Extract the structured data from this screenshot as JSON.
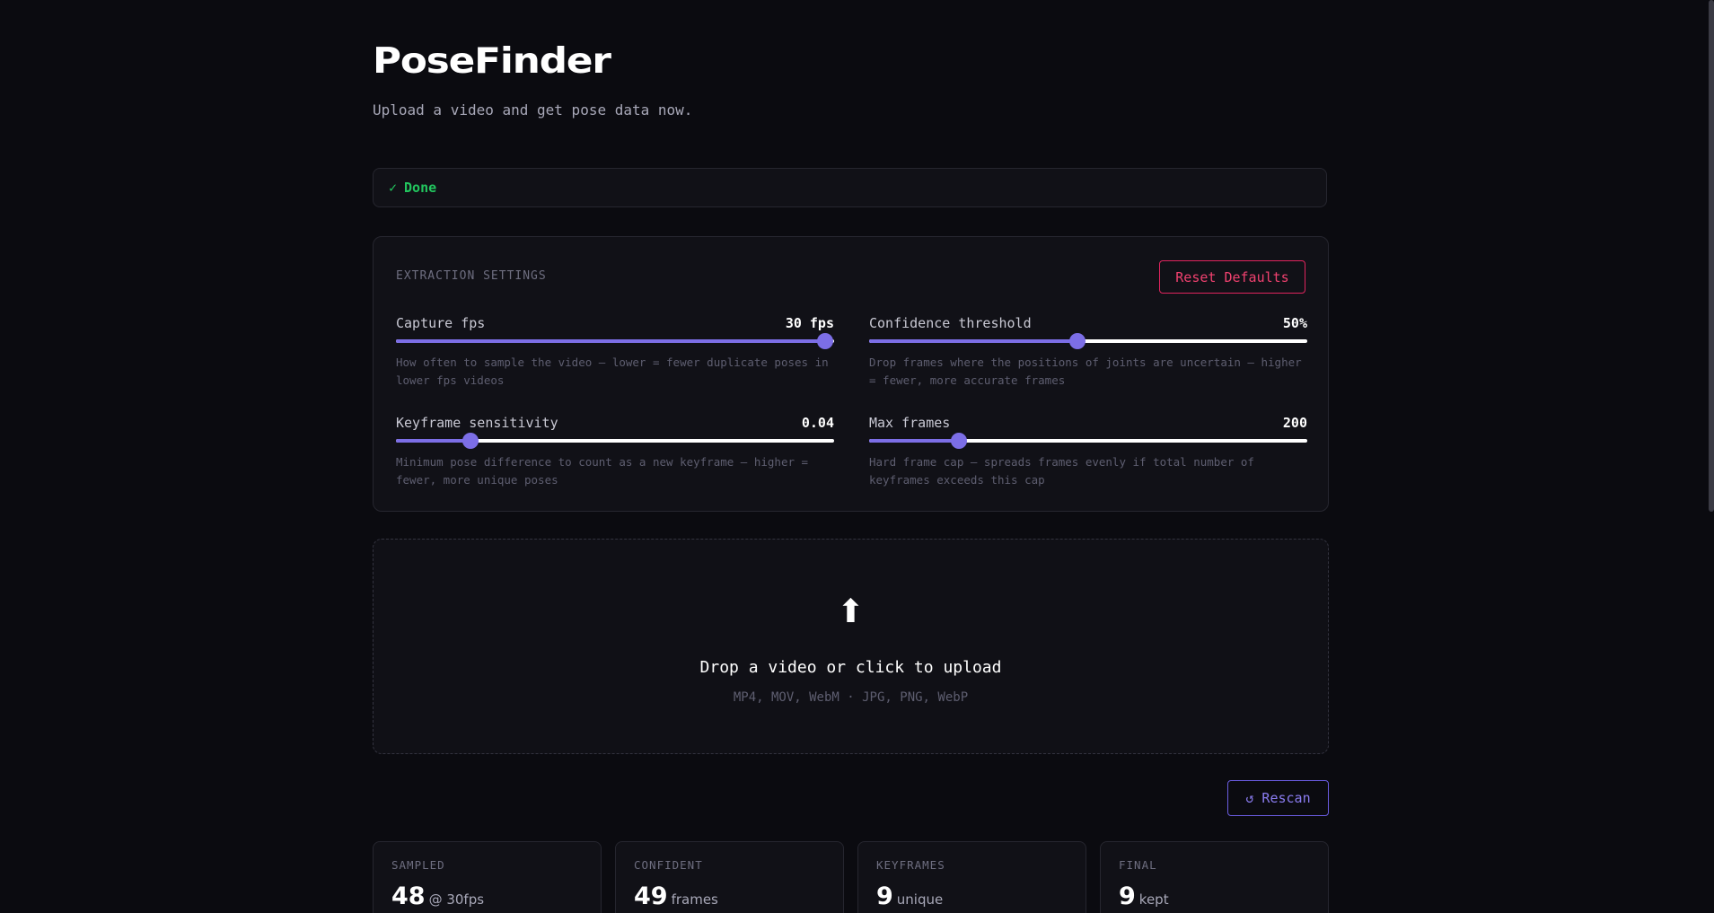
{
  "header": {
    "title": "PoseFinder",
    "subtitle": "Upload a video and get pose data now."
  },
  "status": {
    "icon": "check-icon",
    "symbol": "✓",
    "text": "Done",
    "color": "#22c55e"
  },
  "settings": {
    "section_label": "EXTRACTION SETTINGS",
    "reset_label": "Reset Defaults",
    "sliders": [
      {
        "label": "Capture fps",
        "value": "30 fps",
        "fraction": 0.98,
        "help": "How often to sample the video — lower = fewer duplicate poses in lower fps videos"
      },
      {
        "label": "Confidence threshold",
        "value": "50%",
        "fraction": 0.475,
        "help": "Drop frames where the positions of joints are uncertain — higher = fewer, more accurate frames"
      },
      {
        "label": "Keyframe sensitivity",
        "value": "0.04",
        "fraction": 0.17,
        "help": "Minimum pose difference to count as a new keyframe — higher = fewer, more unique poses"
      },
      {
        "label": "Max frames",
        "value": "200",
        "fraction": 0.205,
        "help": "Hard frame cap — spreads frames evenly if total number of keyframes exceeds this cap"
      }
    ]
  },
  "upload": {
    "icon": "upload-arrow-icon",
    "symbol": "⬆",
    "title": "Drop a video or click to upload",
    "formats": "MP4, MOV, WebM · JPG, PNG, WebP"
  },
  "rescan": {
    "icon": "refresh-icon",
    "label": "↺ Rescan"
  },
  "stats": [
    {
      "label": "SAMPLED",
      "value": "48",
      "unit": "@ 30fps"
    },
    {
      "label": "CONFIDENT",
      "value": "49",
      "unit": "frames"
    },
    {
      "label": "KEYFRAMES",
      "value": "9",
      "unit": "unique"
    },
    {
      "label": "FINAL",
      "value": "9",
      "unit": "kept"
    }
  ],
  "colors": {
    "accent": "#7c6ee6",
    "danger": "#e0245e",
    "background": "#0b0b10"
  }
}
